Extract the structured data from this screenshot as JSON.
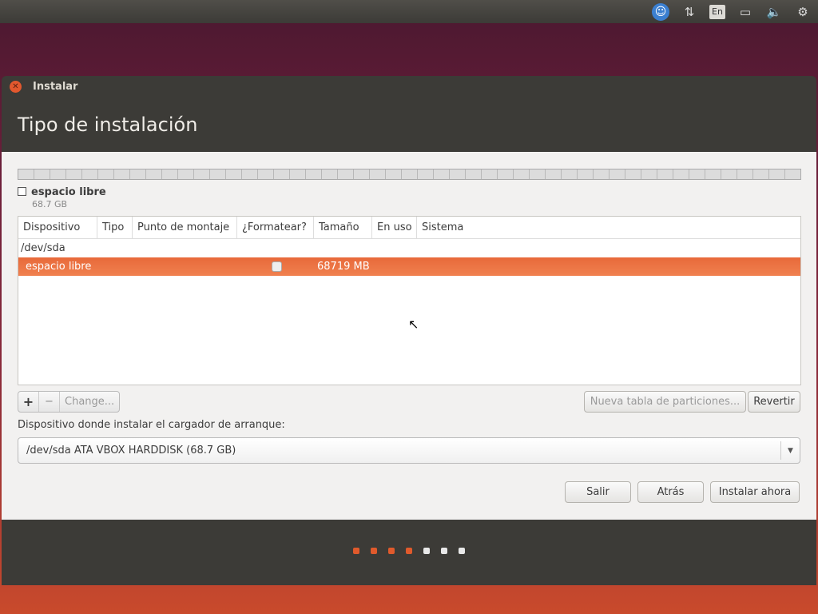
{
  "panel": {
    "language": "En",
    "icons": [
      "accessibility-icon",
      "network-icon",
      "keyboard-language-icon",
      "battery-icon",
      "volume-icon",
      "settings-gear-icon"
    ]
  },
  "window": {
    "title": "Instalar",
    "heading": "Tipo de instalación"
  },
  "disk_bar": {
    "legend_label": "espacio libre",
    "legend_size": "68.7 GB"
  },
  "table": {
    "headers": [
      "Dispositivo",
      "Tipo",
      "Punto de montaje",
      "¿Formatear?",
      "Tamaño",
      "En uso",
      "Sistema"
    ],
    "device": "/dev/sda",
    "rows": [
      {
        "device": "espacio libre",
        "format": false,
        "size": "68719 MB"
      }
    ]
  },
  "tools": {
    "add": "+",
    "remove": "−",
    "change": "Change...",
    "new_table": "Nueva tabla de particiones...",
    "revert": "Revertir"
  },
  "bootloader": {
    "label": "Dispositivo donde instalar el cargador de arranque:",
    "value": "/dev/sda  ATA VBOX HARDDISK (68.7 GB)"
  },
  "buttons": {
    "quit": "Salir",
    "back": "Atrás",
    "install": "Instalar ahora"
  },
  "progress": {
    "steps_total": 7,
    "steps_done": 4,
    "active_color": "#e05a2c",
    "inactive_color": "#e8e8e8"
  }
}
